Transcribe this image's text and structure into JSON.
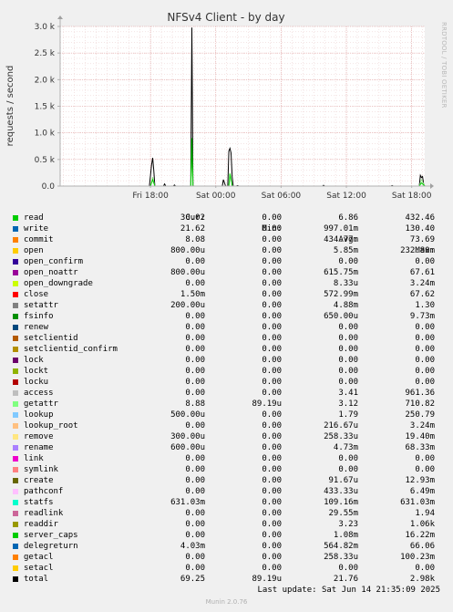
{
  "chart_data": {
    "type": "line",
    "title": "NFSv4 Client - by day",
    "ylabel": "requests / second",
    "xlabel": "",
    "ylim": [
      0,
      3000
    ],
    "yticks": [
      "0.0",
      "0.5 k",
      "1.0 k",
      "1.5 k",
      "2.0 k",
      "2.5 k",
      "3.0 k"
    ],
    "yticks_values": [
      0,
      500,
      1000,
      1500,
      2000,
      2500,
      3000
    ],
    "xticks": [
      "Fri 18:00",
      "Sat 00:00",
      "Sat 06:00",
      "Sat 12:00",
      "Sat 18:00"
    ],
    "xticks_hours": [
      8.3,
      14.3,
      20.3,
      26.3,
      32.3
    ],
    "x_range_hours": [
      0,
      33.5
    ],
    "grid": true,
    "series": [
      {
        "name": "total",
        "color": "#000000",
        "points": [
          [
            0,
            0
          ],
          [
            8.2,
            0
          ],
          [
            8.4,
            400
          ],
          [
            8.5,
            530
          ],
          [
            8.6,
            300
          ],
          [
            8.7,
            0
          ],
          [
            9.5,
            0
          ],
          [
            9.6,
            40
          ],
          [
            9.7,
            0
          ],
          [
            10.4,
            0
          ],
          [
            10.5,
            20
          ],
          [
            10.6,
            0
          ],
          [
            11.8,
            0
          ],
          [
            12,
            0
          ],
          [
            12.1,
            2980
          ],
          [
            12.2,
            0
          ],
          [
            12.4,
            0
          ],
          [
            14.9,
            0
          ],
          [
            15,
            120
          ],
          [
            15.1,
            60
          ],
          [
            15.2,
            0
          ],
          [
            15.4,
            0
          ],
          [
            15.5,
            660
          ],
          [
            15.6,
            710
          ],
          [
            15.7,
            620
          ],
          [
            15.8,
            180
          ],
          [
            15.9,
            0
          ],
          [
            16.2,
            0
          ],
          [
            16.3,
            10
          ],
          [
            16.4,
            0
          ],
          [
            24.1,
            0
          ],
          [
            24.2,
            15
          ],
          [
            24.3,
            0
          ],
          [
            30.4,
            0
          ],
          [
            30.5,
            10
          ],
          [
            30.6,
            0
          ],
          [
            33,
            0
          ],
          [
            33.1,
            200
          ],
          [
            33.2,
            160
          ],
          [
            33.3,
            180
          ],
          [
            33.4,
            40
          ],
          [
            33.5,
            0
          ]
        ]
      },
      {
        "name": "getattr",
        "color": "#96e78b",
        "points": [
          [
            0,
            0
          ],
          [
            8.3,
            0
          ],
          [
            8.5,
            170
          ],
          [
            8.7,
            0
          ],
          [
            12,
            0
          ],
          [
            12.1,
            600
          ],
          [
            12.2,
            0
          ],
          [
            15.5,
            0
          ],
          [
            15.6,
            250
          ],
          [
            15.8,
            0
          ],
          [
            33,
            0
          ],
          [
            33.2,
            120
          ],
          [
            33.5,
            0
          ]
        ]
      },
      {
        "name": "read",
        "color": "#00cc00",
        "points": [
          [
            0,
            0
          ],
          [
            8.3,
            0
          ],
          [
            8.5,
            120
          ],
          [
            8.7,
            0
          ],
          [
            12,
            0
          ],
          [
            12.1,
            900
          ],
          [
            12.2,
            0
          ],
          [
            15.5,
            0
          ],
          [
            15.6,
            230
          ],
          [
            15.8,
            0
          ],
          [
            33,
            0
          ],
          [
            33.2,
            60
          ],
          [
            33.5,
            0
          ]
        ]
      }
    ],
    "legend_header": [
      "Cur:",
      "Min:",
      "Avg:",
      "Max:"
    ],
    "legend": [
      {
        "name": "read",
        "color": "#00cc00",
        "cur": "30.02",
        "min": "0.00",
        "avg": "6.86",
        "max": "432.46"
      },
      {
        "name": "write",
        "color": "#0066b3",
        "cur": "21.62",
        "min": "0.00",
        "avg": "997.01m",
        "max": "130.40"
      },
      {
        "name": "commit",
        "color": "#ff8000",
        "cur": "8.08",
        "min": "0.00",
        "avg": "434.77m",
        "max": "73.69"
      },
      {
        "name": "open",
        "color": "#ffcc00",
        "cur": "800.00u",
        "min": "0.00",
        "avg": "5.85m",
        "max": "232.80m"
      },
      {
        "name": "open_confirm",
        "color": "#330099",
        "cur": "0.00",
        "min": "0.00",
        "avg": "0.00",
        "max": "0.00"
      },
      {
        "name": "open_noattr",
        "color": "#990099",
        "cur": "800.00u",
        "min": "0.00",
        "avg": "615.75m",
        "max": "67.61"
      },
      {
        "name": "open_downgrade",
        "color": "#ccff00",
        "cur": "0.00",
        "min": "0.00",
        "avg": "8.33u",
        "max": "3.24m"
      },
      {
        "name": "close",
        "color": "#ff0000",
        "cur": "1.50m",
        "min": "0.00",
        "avg": "572.99m",
        "max": "67.62"
      },
      {
        "name": "setattr",
        "color": "#808080",
        "cur": "200.00u",
        "min": "0.00",
        "avg": "4.88m",
        "max": "1.30"
      },
      {
        "name": "fsinfo",
        "color": "#008f00",
        "cur": "0.00",
        "min": "0.00",
        "avg": "650.00u",
        "max": "9.73m"
      },
      {
        "name": "renew",
        "color": "#00487d",
        "cur": "0.00",
        "min": "0.00",
        "avg": "0.00",
        "max": "0.00"
      },
      {
        "name": "setclientid",
        "color": "#b35a00",
        "cur": "0.00",
        "min": "0.00",
        "avg": "0.00",
        "max": "0.00"
      },
      {
        "name": "setclientid_confirm",
        "color": "#b38f00",
        "cur": "0.00",
        "min": "0.00",
        "avg": "0.00",
        "max": "0.00"
      },
      {
        "name": "lock",
        "color": "#6b006b",
        "cur": "0.00",
        "min": "0.00",
        "avg": "0.00",
        "max": "0.00"
      },
      {
        "name": "lockt",
        "color": "#8fb300",
        "cur": "0.00",
        "min": "0.00",
        "avg": "0.00",
        "max": "0.00"
      },
      {
        "name": "locku",
        "color": "#b30000",
        "cur": "0.00",
        "min": "0.00",
        "avg": "0.00",
        "max": "0.00"
      },
      {
        "name": "access",
        "color": "#bebebe",
        "cur": "0.00",
        "min": "0.00",
        "avg": "3.41",
        "max": "961.36"
      },
      {
        "name": "getattr",
        "color": "#80ff80",
        "cur": "8.88",
        "min": "89.19u",
        "avg": "3.12",
        "max": "710.82"
      },
      {
        "name": "lookup",
        "color": "#80c9ff",
        "cur": "500.00u",
        "min": "0.00",
        "avg": "1.79",
        "max": "250.79"
      },
      {
        "name": "lookup_root",
        "color": "#ffc080",
        "cur": "0.00",
        "min": "0.00",
        "avg": "216.67u",
        "max": "3.24m"
      },
      {
        "name": "remove",
        "color": "#ffe680",
        "cur": "300.00u",
        "min": "0.00",
        "avg": "258.33u",
        "max": "19.40m"
      },
      {
        "name": "rename",
        "color": "#aa80ff",
        "cur": "600.00u",
        "min": "0.00",
        "avg": "4.73m",
        "max": "68.33m"
      },
      {
        "name": "link",
        "color": "#ee00cc",
        "cur": "0.00",
        "min": "0.00",
        "avg": "0.00",
        "max": "0.00"
      },
      {
        "name": "symlink",
        "color": "#ff8080",
        "cur": "0.00",
        "min": "0.00",
        "avg": "0.00",
        "max": "0.00"
      },
      {
        "name": "create",
        "color": "#666600",
        "cur": "0.00",
        "min": "0.00",
        "avg": "91.67u",
        "max": "12.93m"
      },
      {
        "name": "pathconf",
        "color": "#ffbfff",
        "cur": "0.00",
        "min": "0.00",
        "avg": "433.33u",
        "max": "6.49m"
      },
      {
        "name": "statfs",
        "color": "#00ffcc",
        "cur": "631.03m",
        "min": "0.00",
        "avg": "109.16m",
        "max": "631.03m"
      },
      {
        "name": "readlink",
        "color": "#cc6699",
        "cur": "0.00",
        "min": "0.00",
        "avg": "29.55m",
        "max": "1.94"
      },
      {
        "name": "readdir",
        "color": "#999900",
        "cur": "0.00",
        "min": "0.00",
        "avg": "3.23",
        "max": "1.06k"
      },
      {
        "name": "server_caps",
        "color": "#00cc00",
        "cur": "0.00",
        "min": "0.00",
        "avg": "1.08m",
        "max": "16.22m"
      },
      {
        "name": "delegreturn",
        "color": "#0066b3",
        "cur": "4.03m",
        "min": "0.00",
        "avg": "564.82m",
        "max": "66.06"
      },
      {
        "name": "getacl",
        "color": "#ff8000",
        "cur": "0.00",
        "min": "0.00",
        "avg": "258.33u",
        "max": "100.23m"
      },
      {
        "name": "setacl",
        "color": "#ffcc00",
        "cur": "0.00",
        "min": "0.00",
        "avg": "0.00",
        "max": "0.00"
      },
      {
        "name": "total",
        "color": "#000000",
        "cur": "69.25",
        "min": "89.19u",
        "avg": "21.76",
        "max": "2.98k"
      }
    ]
  },
  "footer": {
    "last_update": "Last update: Sat Jun 14 21:35:09 2025",
    "munin_version": "Munin 2.0.76",
    "side_label": "RRDTOOL / TOBI OETIKER"
  },
  "colors": {
    "background": "#f0f0f0",
    "plot_background": "#ffffff",
    "grid_minor": "#e4b4b4",
    "axis": "#c0c0c0"
  }
}
